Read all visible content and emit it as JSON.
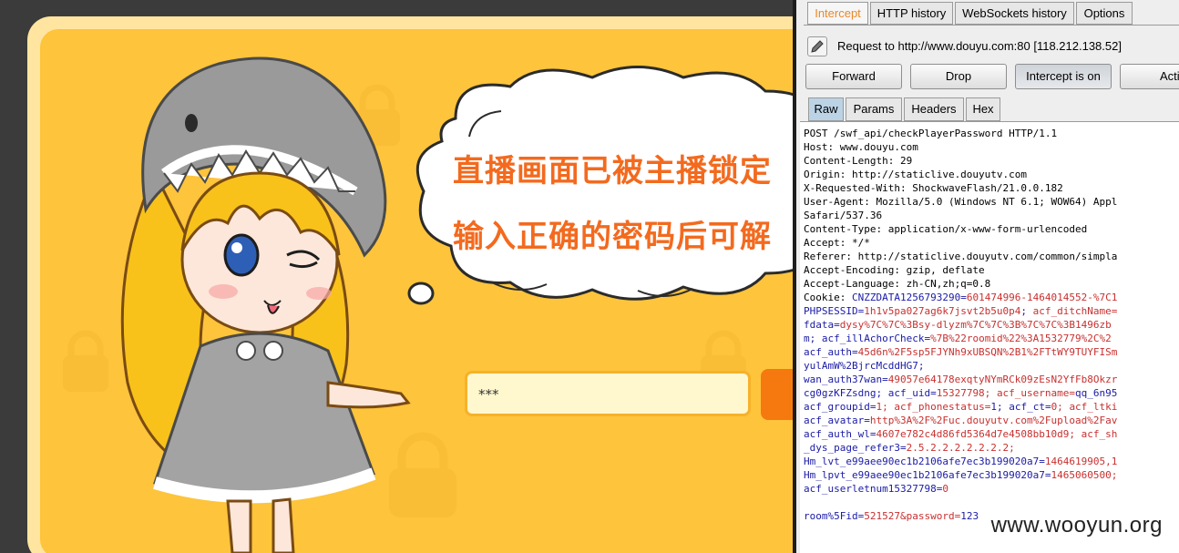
{
  "flash": {
    "line1": "直播画面已被主播锁定",
    "line2": "输入正确的密码后可解",
    "password_value": "***"
  },
  "burp": {
    "tabs": [
      {
        "label": "Intercept",
        "active": true
      },
      {
        "label": "HTTP history"
      },
      {
        "label": "WebSockets history"
      },
      {
        "label": "Options"
      }
    ],
    "request_label": "Request to http://www.douyu.com:80  [118.212.138.52]",
    "buttons": {
      "forward": "Forward",
      "drop": "Drop",
      "intercept": "Intercept is on",
      "action": "Action"
    },
    "subtabs": [
      {
        "label": "Raw",
        "active": true
      },
      {
        "label": "Params"
      },
      {
        "label": "Headers"
      },
      {
        "label": "Hex"
      }
    ],
    "lines": [
      [
        "POST /swf_api/checkPlayerPassword HTTP/1.1"
      ],
      [
        "Host: www.douyu.com"
      ],
      [
        "Content-Length: 29"
      ],
      [
        "Origin: http://staticlive.douyutv.com"
      ],
      [
        "X-Requested-With: ShockwaveFlash/21.0.0.182"
      ],
      [
        "User-Agent: Mozilla/5.0 (Windows NT 6.1; WOW64) Appl"
      ],
      [
        "Safari/537.36"
      ],
      [
        "Content-Type: application/x-www-form-urlencoded"
      ],
      [
        "Accept: */*"
      ],
      [
        "Referer: http://staticlive.douyutv.com/common/simpla"
      ],
      [
        "Accept-Encoding: gzip, deflate"
      ],
      [
        "Accept-Language: zh-CN,zh;q=0.8"
      ],
      [
        "Cookie: ",
        "CNZZDATA1256793290=",
        "601474996-1464014552-%7C1"
      ],
      [
        "",
        "PHPSESSID=",
        "1h1v5pa027ag6k7jsvt2b5u0p4",
        "; ",
        "acf_ditchName="
      ],
      [
        "",
        "fdata=",
        "dysy%7C%7C%3Bsy-dlyzm%7C%7C%3B%7C%7C%3B1496zb"
      ],
      [
        "",
        "m; ",
        "",
        "acf_illAchorCheck=",
        "%7B%22roomid%22%3A1532779%2C%2"
      ],
      [
        "",
        "acf_auth=",
        "45d6n%2F5sp5FJYNh9xUBSQN%2B1%2FTtWY9TUYFISm"
      ],
      [
        "",
        "yulAmW%2BjrcMcddHG7;"
      ],
      [
        "",
        "wan_auth37wan=",
        "49057e64178exqtyNYmRCk09zEsN2YfFb8Okzr"
      ],
      [
        "",
        "cg0gzKFZsdng; ",
        "",
        "acf_uid=",
        "15327798; ",
        "",
        "acf_username=",
        "qq_6n95"
      ],
      [
        "",
        "acf_groupid=",
        "1; ",
        "",
        "acf_phonestatus=",
        "1; ",
        "",
        "acf_ct=",
        "0; ",
        "",
        "acf_ltki"
      ],
      [
        "",
        "acf_avatar=",
        "http%3A%2F%2Fuc.douyutv.com%2Fupload%2Fav"
      ],
      [
        "",
        "acf_auth_wl=",
        "4607e782c4d86fd5364d7e4508bb10d9; ",
        "",
        "acf_sh"
      ],
      [
        "",
        "_dys_page_refer3=",
        "2.5.2.2.2.2.2.2.2;"
      ],
      [
        "",
        "Hm_lvt_e99aee90ec1b2106afe7ec3b199020a7=",
        "1464619905,1"
      ],
      [
        "",
        "Hm_lpvt_e99aee90ec1b2106afe7ec3b199020a7=",
        "1465060500;"
      ],
      [
        "",
        "acf_userletnum15327798=",
        "0"
      ],
      [
        ""
      ],
      [
        "",
        "room%5Fid=",
        "521527&",
        "",
        "password=",
        "123"
      ]
    ]
  },
  "watermark": "www.wooyun.org"
}
